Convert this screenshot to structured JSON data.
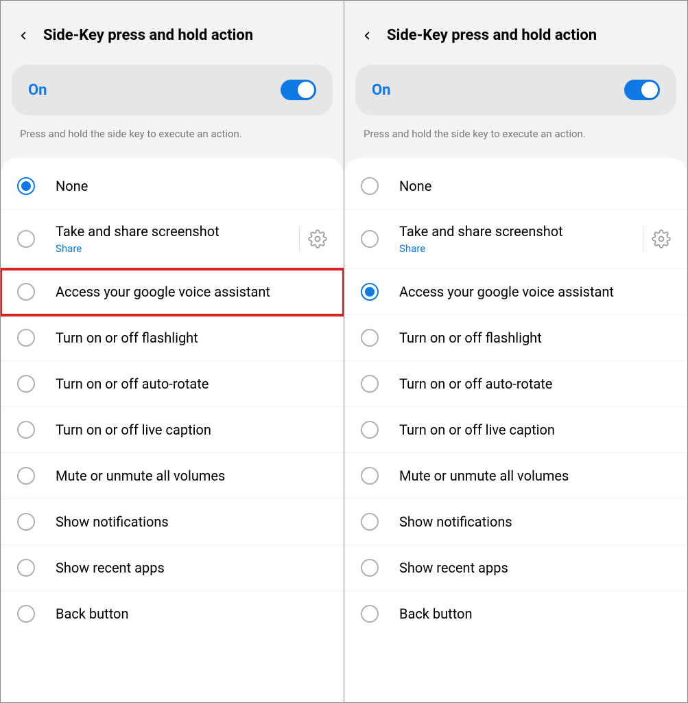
{
  "panels": [
    {
      "title": "Side-Key press and hold action",
      "toggle_label": "On",
      "toggle_on": true,
      "description": "Press and hold the side key to execute an action.",
      "items": [
        {
          "label": "None",
          "sublabel": null,
          "selected": true,
          "gear": false,
          "highlighted": false
        },
        {
          "label": "Take and share screenshot",
          "sublabel": "Share",
          "selected": false,
          "gear": true,
          "highlighted": false
        },
        {
          "label": "Access your google voice assistant",
          "sublabel": null,
          "selected": false,
          "gear": false,
          "highlighted": true
        },
        {
          "label": "Turn on or off flashlight",
          "sublabel": null,
          "selected": false,
          "gear": false,
          "highlighted": false
        },
        {
          "label": "Turn on or off auto-rotate",
          "sublabel": null,
          "selected": false,
          "gear": false,
          "highlighted": false
        },
        {
          "label": "Turn on or off live caption",
          "sublabel": null,
          "selected": false,
          "gear": false,
          "highlighted": false
        },
        {
          "label": "Mute or unmute all volumes",
          "sublabel": null,
          "selected": false,
          "gear": false,
          "highlighted": false
        },
        {
          "label": "Show notifications",
          "sublabel": null,
          "selected": false,
          "gear": false,
          "highlighted": false
        },
        {
          "label": "Show recent apps",
          "sublabel": null,
          "selected": false,
          "gear": false,
          "highlighted": false
        },
        {
          "label": "Back button",
          "sublabel": null,
          "selected": false,
          "gear": false,
          "highlighted": false
        }
      ]
    },
    {
      "title": "Side-Key press and hold action",
      "toggle_label": "On",
      "toggle_on": true,
      "description": "Press and hold the side key to execute an action.",
      "items": [
        {
          "label": "None",
          "sublabel": null,
          "selected": false,
          "gear": false,
          "highlighted": false
        },
        {
          "label": "Take and share screenshot",
          "sublabel": "Share",
          "selected": false,
          "gear": true,
          "highlighted": false
        },
        {
          "label": "Access your google voice assistant",
          "sublabel": null,
          "selected": true,
          "gear": false,
          "highlighted": false
        },
        {
          "label": "Turn on or off flashlight",
          "sublabel": null,
          "selected": false,
          "gear": false,
          "highlighted": false
        },
        {
          "label": "Turn on or off auto-rotate",
          "sublabel": null,
          "selected": false,
          "gear": false,
          "highlighted": false
        },
        {
          "label": "Turn on or off live caption",
          "sublabel": null,
          "selected": false,
          "gear": false,
          "highlighted": false
        },
        {
          "label": "Mute or unmute all volumes",
          "sublabel": null,
          "selected": false,
          "gear": false,
          "highlighted": false
        },
        {
          "label": "Show notifications",
          "sublabel": null,
          "selected": false,
          "gear": false,
          "highlighted": false
        },
        {
          "label": "Show recent apps",
          "sublabel": null,
          "selected": false,
          "gear": false,
          "highlighted": false
        },
        {
          "label": "Back button",
          "sublabel": null,
          "selected": false,
          "gear": false,
          "highlighted": false
        }
      ]
    }
  ]
}
